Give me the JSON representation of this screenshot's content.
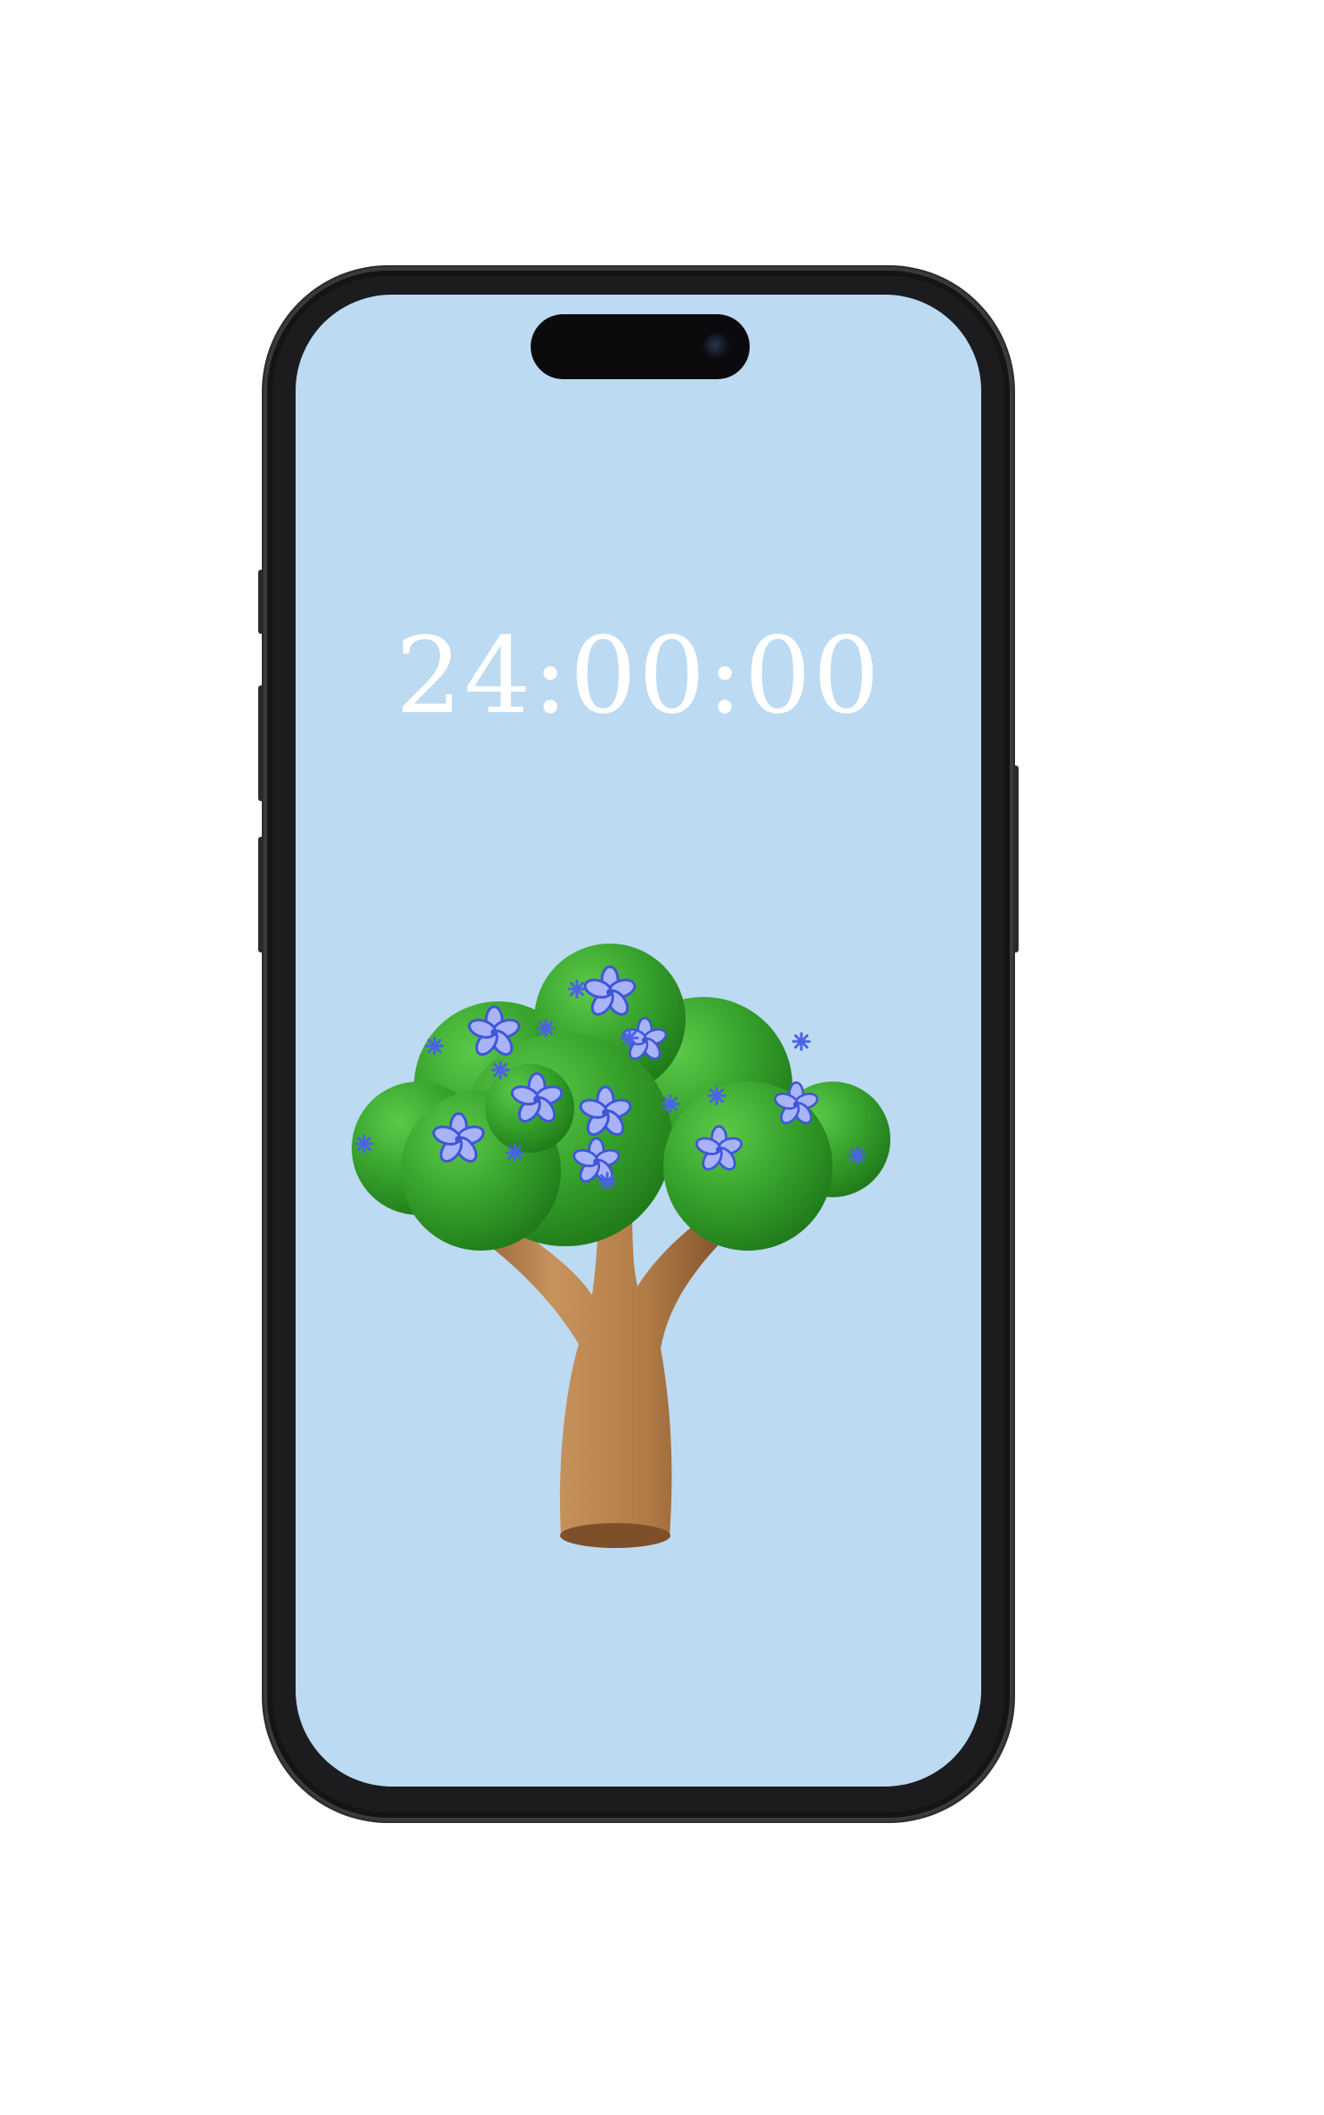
{
  "lock_screen": {
    "time": "24:00:00"
  },
  "wallpaper": {
    "subject": "tree-icon"
  },
  "colors": {
    "screen_background": "#bcdaf2",
    "phone_frame": "#1c1c1e",
    "clock_text": "#ffffff",
    "foliage": "#3aa62e",
    "trunk": "#b07a45",
    "flower": "#5a6ee8"
  }
}
